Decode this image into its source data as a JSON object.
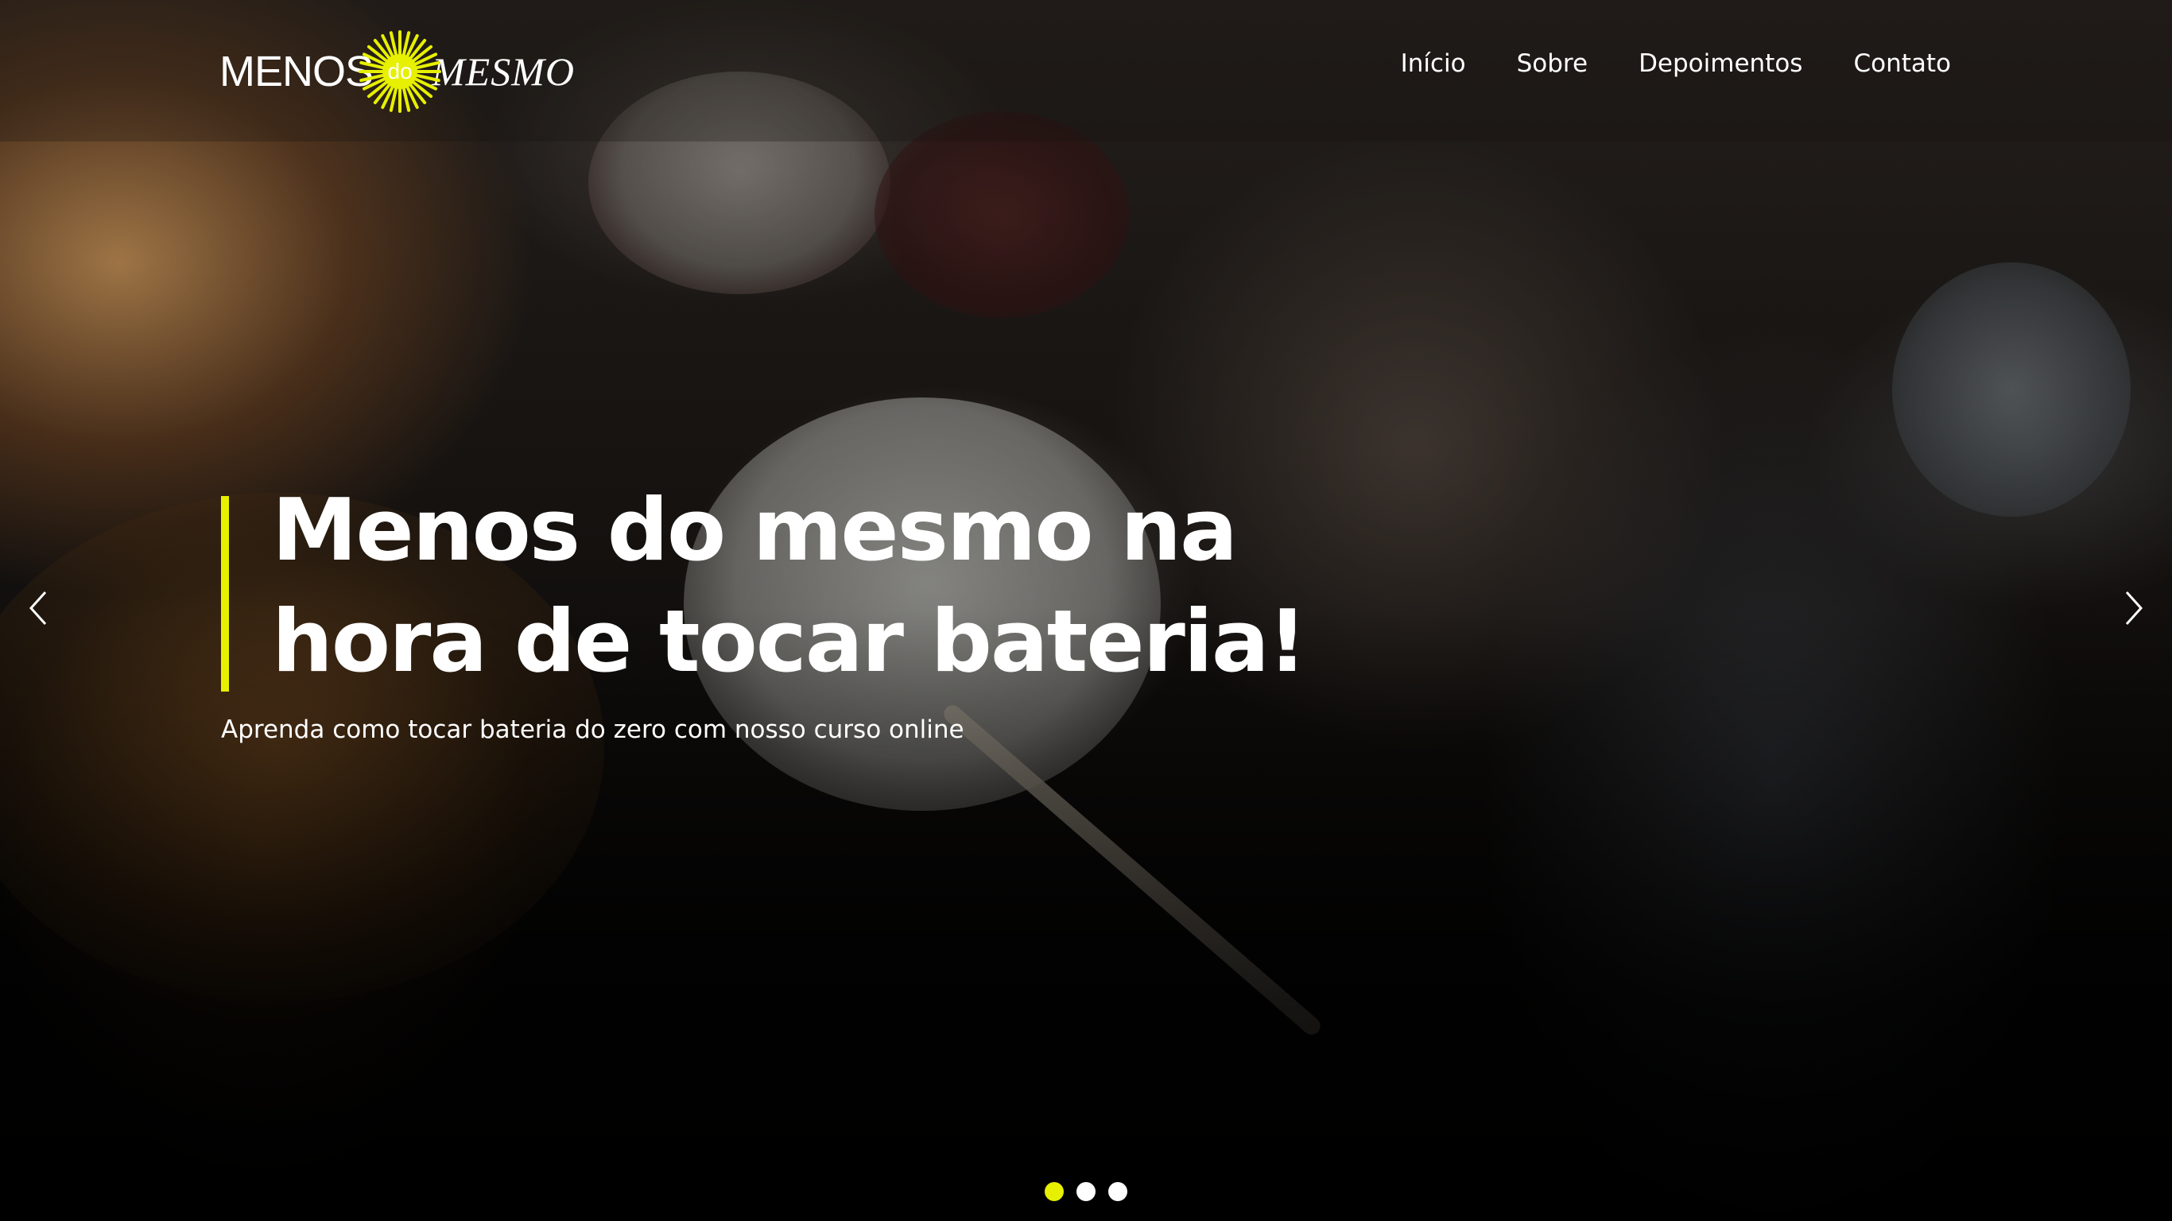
{
  "header": {
    "logo": {
      "left_text": "MENOS",
      "middle_text": "do",
      "right_text": "MESMO",
      "sun_color": "#e6f000"
    },
    "nav": [
      {
        "label": "Início"
      },
      {
        "label": "Sobre"
      },
      {
        "label": "Depoimentos"
      },
      {
        "label": "Contato"
      }
    ]
  },
  "hero": {
    "headline_line1": "Menos do mesmo na",
    "headline_line2": "hora de tocar bateria!",
    "subtitle": "Aprenda como tocar bateria do zero com nosso curso online",
    "accent_color": "#e6f000",
    "prev_icon": "chevron-left-icon",
    "next_icon": "chevron-right-icon"
  },
  "carousel": {
    "slide_count": 3,
    "active_index": 0,
    "active_color": "#e6f000",
    "inactive_color": "#ffffff"
  }
}
